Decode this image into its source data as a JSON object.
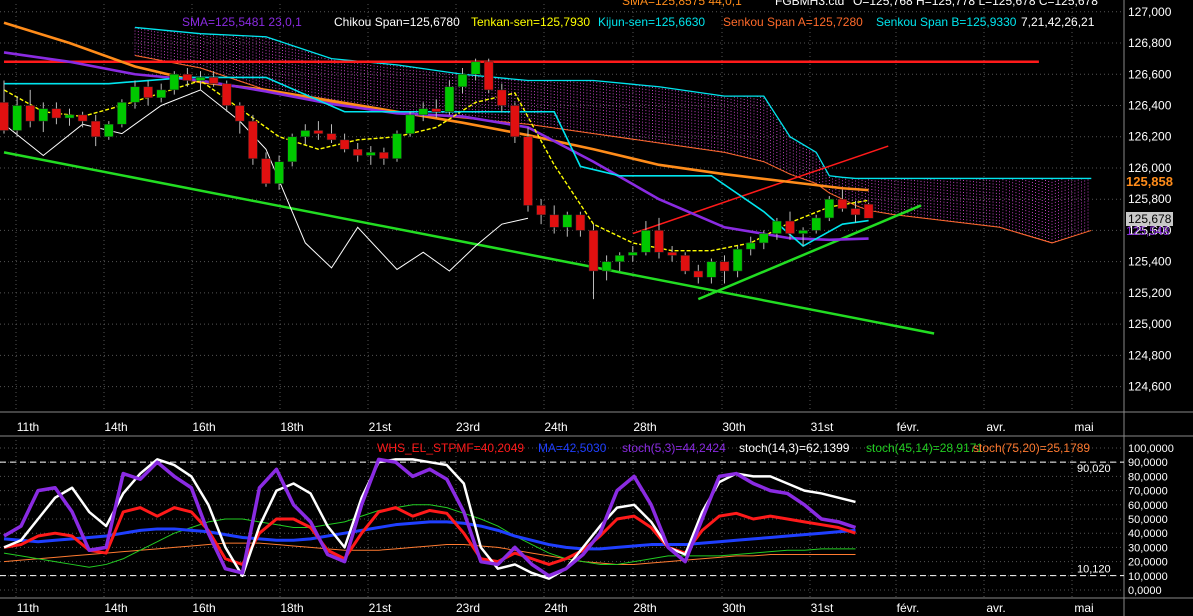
{
  "header": {
    "symbol": "FGBMH3.ctd",
    "ohlc": "O=125,768 H=125,778 L=125,678 C=125,678",
    "sma_main": "SMA=125,8575  44,0,1",
    "sma2": "SMA=125,5481  23,0,1",
    "chikou": "Chikou Span=125,6780",
    "tenkan": "Tenkan-sen=125,7930",
    "kijun": "Kijun-sen=125,6630",
    "senkou_a": "Senkou Span A=125,7280",
    "senkou_b": "Senkou Span B=125,9330",
    "ichimoku_params": "7,21,42,26,21"
  },
  "lower_header": {
    "whs": "WHS_EL_STPMF=40,2049",
    "ma": "MA=42,5030",
    "stoch53": "stoch(5,3)=44,2424",
    "stoch14": "stoch(14,3)=62,1399",
    "stoch45": "stoch(45,14)=28,9171",
    "stoch75": "stoch(75,20)=25,1789"
  },
  "price_labels": {
    "sma": "125,858",
    "close": "125,678",
    "sma2": "125,548"
  },
  "colors": {
    "bg": "#000000",
    "grid": "#555555",
    "up": "#00c800",
    "down": "#e01010",
    "sma": "#ff8c1a",
    "sma2": "#8a2be2",
    "tenkan": "#ffff00",
    "kijun": "#00e5ee",
    "chikou": "#ffffff",
    "cloud_b": "#00e5ee",
    "cloud_a": "#ff6a2a",
    "cloud_fill": "#ff55ff",
    "trend_red": "#ff1a1a",
    "trend_green": "#22dd22",
    "stoch5": "#8a2be2",
    "stoch14": "#ffffff",
    "whs": "#ff1a1a",
    "ma": "#1f3fff",
    "stoch45": "#22cc22",
    "stoch75": "#ff7a30"
  },
  "chart_data": [
    {
      "type": "candlestick",
      "title": "",
      "ylim": [
        124450,
        127050
      ],
      "y_ticks": [
        "127,000",
        "126,800",
        "126,600",
        "126,400",
        "126,200",
        "126,000",
        "125,800",
        "125,600",
        "125,400",
        "125,200",
        "125,000",
        "124,800",
        "124,600"
      ],
      "x_ticks": [
        "11th",
        "14th",
        "16th",
        "18th",
        "21st",
        "23rd",
        "24th",
        "28th",
        "30th",
        "31st",
        "févr.",
        "avr.",
        "mai"
      ],
      "candles": [
        [
          126420,
          126560,
          126220,
          126240
        ],
        [
          126240,
          126460,
          126200,
          126400
        ],
        [
          126400,
          126500,
          126260,
          126300
        ],
        [
          126300,
          126420,
          126230,
          126380
        ],
        [
          126380,
          126420,
          126280,
          126320
        ],
        [
          126320,
          126380,
          126270,
          126340
        ],
        [
          126340,
          126360,
          126260,
          126300
        ],
        [
          126300,
          126340,
          126140,
          126200
        ],
        [
          126200,
          126300,
          126180,
          126280
        ],
        [
          126280,
          126440,
          126260,
          126420
        ],
        [
          126420,
          126560,
          126380,
          126520
        ],
        [
          126520,
          126560,
          126400,
          126450
        ],
        [
          126450,
          126540,
          126420,
          126500
        ],
        [
          126500,
          126620,
          126470,
          126600
        ],
        [
          126600,
          126640,
          126520,
          126560
        ],
        [
          126560,
          126620,
          126500,
          126580
        ],
        [
          126580,
          126620,
          126520,
          126540
        ],
        [
          126540,
          126560,
          126360,
          126400
        ],
        [
          126400,
          126420,
          126220,
          126300
        ],
        [
          126300,
          126340,
          126020,
          126060
        ],
        [
          126060,
          126100,
          125880,
          125900
        ],
        [
          125900,
          126080,
          125860,
          126040
        ],
        [
          126040,
          126220,
          126010,
          126200
        ],
        [
          126200,
          126280,
          126150,
          126240
        ],
        [
          126240,
          126300,
          126180,
          126220
        ],
        [
          126220,
          126280,
          126160,
          126180
        ],
        [
          126180,
          126220,
          126100,
          126120
        ],
        [
          126120,
          126160,
          126040,
          126080
        ],
        [
          126080,
          126140,
          126020,
          126100
        ],
        [
          126100,
          126130,
          126020,
          126060
        ],
        [
          126060,
          126240,
          126040,
          126220
        ],
        [
          126220,
          126360,
          126200,
          126340
        ],
        [
          126340,
          126420,
          126300,
          126380
        ],
        [
          126380,
          126440,
          126320,
          126360
        ],
        [
          126360,
          126560,
          126340,
          126520
        ],
        [
          126520,
          126640,
          126480,
          126600
        ],
        [
          126600,
          126700,
          126560,
          126680
        ],
        [
          126680,
          126700,
          126480,
          126500
        ],
        [
          126500,
          126540,
          126360,
          126400
        ],
        [
          126400,
          126420,
          126160,
          126200
        ],
        [
          126200,
          126260,
          125720,
          125760
        ],
        [
          125760,
          125800,
          125640,
          125700
        ],
        [
          125700,
          125760,
          125580,
          125620
        ],
        [
          125620,
          125720,
          125560,
          125700
        ],
        [
          125700,
          125720,
          125560,
          125600
        ],
        [
          125600,
          125640,
          125160,
          125340
        ],
        [
          125340,
          125440,
          125280,
          125400
        ],
        [
          125400,
          125460,
          125340,
          125440
        ],
        [
          125440,
          125500,
          125400,
          125460
        ],
        [
          125460,
          125660,
          125440,
          125600
        ],
        [
          125600,
          125680,
          125420,
          125460
        ],
        [
          125460,
          125500,
          125400,
          125440
        ],
        [
          125440,
          125460,
          125320,
          125340
        ],
        [
          125340,
          125380,
          125260,
          125300
        ],
        [
          125300,
          125420,
          125260,
          125400
        ],
        [
          125400,
          125440,
          125260,
          125340
        ],
        [
          125340,
          125500,
          125300,
          125480
        ],
        [
          125480,
          125560,
          125440,
          125520
        ],
        [
          125520,
          125600,
          125480,
          125580
        ],
        [
          125580,
          125680,
          125540,
          125660
        ],
        [
          125660,
          125720,
          125540,
          125580
        ],
        [
          125580,
          125620,
          125500,
          125600
        ],
        [
          125600,
          125700,
          125580,
          125680
        ],
        [
          125680,
          125820,
          125660,
          125800
        ],
        [
          125800,
          125860,
          125720,
          125740
        ],
        [
          125740,
          125790,
          125650,
          125700
        ],
        [
          125768,
          125778,
          125678,
          125678
        ]
      ],
      "series": [
        {
          "key": "sma",
          "name": "SMA",
          "x": [
            0,
            5,
            10,
            15,
            20,
            25,
            30,
            35,
            40,
            45,
            50,
            55,
            60,
            64,
            66
          ],
          "y": [
            126930,
            126800,
            126650,
            126550,
            126500,
            126430,
            126360,
            126290,
            126210,
            126120,
            126020,
            125960,
            125910,
            125870,
            125858
          ]
        },
        {
          "key": "sma2",
          "name": "SMA",
          "x": [
            0,
            5,
            10,
            15,
            20,
            25,
            30,
            35,
            40,
            45,
            50,
            55,
            60,
            63,
            66
          ],
          "y": [
            126740,
            126680,
            126600,
            126560,
            126490,
            126410,
            126350,
            126330,
            126260,
            126040,
            125800,
            125620,
            125550,
            125540,
            125548
          ]
        },
        {
          "key": "tenkan",
          "name": "Tenkan-sen",
          "x": [
            0,
            3,
            6,
            9,
            12,
            15,
            18,
            21,
            24,
            27,
            30,
            33,
            36,
            39,
            42,
            45,
            48,
            51,
            54,
            57,
            60,
            63,
            66
          ],
          "y": [
            126500,
            126360,
            126330,
            126400,
            126480,
            126560,
            126380,
            126200,
            126120,
            126180,
            126200,
            126260,
            126420,
            126480,
            126020,
            125640,
            125520,
            125470,
            125470,
            125520,
            125650,
            125750,
            125793
          ]
        },
        {
          "key": "kijun",
          "name": "Kijun-sen",
          "x": [
            0,
            8,
            14,
            20,
            26,
            32,
            38,
            42,
            44,
            47,
            50,
            54,
            58,
            61,
            64,
            66
          ],
          "y": [
            126540,
            126540,
            126580,
            126580,
            126360,
            126360,
            126360,
            126360,
            126010,
            125950,
            125950,
            125950,
            125720,
            125500,
            125640,
            125663
          ]
        },
        {
          "key": "chikou",
          "name": "Chikou Span",
          "x": [
            0,
            3,
            6,
            9,
            12,
            15,
            18,
            20,
            23,
            25,
            27,
            30,
            32,
            34,
            36,
            38,
            40
          ],
          "y": [
            126280,
            126080,
            126280,
            126220,
            126400,
            126500,
            126300,
            126120,
            125520,
            125360,
            125620,
            125350,
            125460,
            125340,
            125500,
            125640,
            125678
          ]
        }
      ],
      "cloud": {
        "x": [
          10,
          15,
          20,
          25,
          30,
          35,
          40,
          45,
          50,
          55,
          58,
          60,
          62,
          63,
          64,
          65,
          66,
          68,
          72,
          76,
          80,
          83
        ],
        "senkou_a": [
          126720,
          126640,
          126500,
          126420,
          126360,
          126320,
          126280,
          126220,
          126160,
          126100,
          126040,
          125960,
          125900,
          125840,
          125800,
          125760,
          125728,
          125700,
          125660,
          125620,
          125520,
          125600
        ],
        "senkou_b": [
          126900,
          126860,
          126840,
          126700,
          126660,
          126600,
          126560,
          126560,
          126520,
          126460,
          126460,
          126200,
          126100,
          125950,
          125940,
          125933,
          125933,
          125933,
          125933,
          125933,
          125933,
          125933
        ]
      },
      "trendlines": [
        {
          "key": "resistance_red",
          "y_start": 126680,
          "y_end": 126680,
          "x_start": 0,
          "x_end": 79
        },
        {
          "key": "channel_red_up",
          "x_start": 48,
          "y_start": 125580,
          "x_end": 67.5,
          "y_end": 126140
        },
        {
          "key": "channel_green_low",
          "x_start": 53,
          "y_start": 125160,
          "x_end": 70,
          "y_end": 125760
        },
        {
          "key": "support_green",
          "x_start": 0,
          "y_start": 126100,
          "x_end": 71,
          "y_end": 124940
        }
      ]
    },
    {
      "type": "line",
      "title": "",
      "ylim": [
        0,
        100000
      ],
      "y_ticks": [
        "100,0000",
        "90,0000",
        "80,0000",
        "70,0000",
        "60,0000",
        "50,0000",
        "40,0000",
        "30,0000",
        "20,0000",
        "10,0000",
        "0,0000"
      ],
      "levels": [
        "90,020",
        "10,120"
      ],
      "x_ticks": [
        "11th",
        "14th",
        "16th",
        "18th",
        "21st",
        "23rd",
        "24th",
        "28th",
        "30th",
        "31st",
        "févr.",
        "avr.",
        "mai"
      ],
      "series": [
        {
          "key": "stoch5",
          "name": "stoch(5,3)",
          "values": [
            38,
            45,
            70,
            72,
            55,
            28,
            30,
            82,
            78,
            90,
            80,
            72,
            40,
            15,
            12,
            72,
            85,
            60,
            48,
            25,
            20,
            60,
            92,
            90,
            80,
            85,
            78,
            55,
            20,
            18,
            30,
            18,
            10,
            15,
            25,
            40,
            70,
            80,
            60,
            30,
            20,
            50,
            80,
            82,
            75,
            70,
            68,
            60,
            50,
            48,
            44
          ]
        },
        {
          "key": "stoch14",
          "name": "stoch(14,3)",
          "values": [
            30,
            35,
            50,
            65,
            72,
            55,
            45,
            68,
            82,
            92,
            88,
            80,
            60,
            30,
            10,
            45,
            70,
            75,
            68,
            45,
            30,
            65,
            90,
            92,
            92,
            90,
            88,
            75,
            30,
            15,
            18,
            12,
            8,
            15,
            30,
            45,
            58,
            60,
            48,
            30,
            25,
            55,
            76,
            82,
            80,
            80,
            75,
            70,
            68,
            65,
            62
          ]
        },
        {
          "key": "whs",
          "name": "WHS_EL_STPMF",
          "values": [
            30,
            32,
            38,
            40,
            38,
            28,
            26,
            55,
            58,
            52,
            58,
            55,
            42,
            22,
            18,
            40,
            50,
            50,
            44,
            28,
            22,
            40,
            55,
            58,
            52,
            56,
            54,
            40,
            22,
            20,
            26,
            22,
            18,
            22,
            28,
            38,
            50,
            52,
            44,
            30,
            26,
            42,
            52,
            54,
            50,
            52,
            50,
            48,
            46,
            44,
            40
          ]
        },
        {
          "key": "ma",
          "name": "MA",
          "values": [
            36,
            35,
            34,
            35,
            36,
            37,
            38,
            40,
            42,
            43,
            43,
            42,
            41,
            39,
            37,
            36,
            35,
            35,
            36,
            38,
            40,
            42,
            44,
            46,
            47,
            48,
            48,
            47,
            45,
            42,
            38,
            35,
            32,
            30,
            29,
            29,
            30,
            31,
            32,
            32,
            32,
            33,
            34,
            35,
            36,
            37,
            38,
            39,
            40,
            41,
            42
          ]
        },
        {
          "key": "stoch45",
          "name": "stoch(45,14)",
          "values": [
            26,
            24,
            22,
            20,
            18,
            16,
            18,
            22,
            28,
            34,
            40,
            44,
            48,
            50,
            50,
            48,
            46,
            44,
            44,
            46,
            48,
            52,
            56,
            58,
            60,
            60,
            58,
            54,
            50,
            45,
            38,
            32,
            26,
            22,
            20,
            18,
            18,
            20,
            22,
            24,
            24,
            24,
            24,
            25,
            26,
            27,
            28,
            28,
            29,
            29,
            29
          ]
        },
        {
          "key": "stoch75",
          "name": "stoch(75,20)",
          "values": [
            20,
            21,
            22,
            23,
            24,
            25,
            26,
            27,
            28,
            29,
            30,
            31,
            32,
            33,
            33,
            33,
            32,
            31,
            30,
            29,
            28,
            28,
            28,
            29,
            30,
            31,
            32,
            32,
            31,
            30,
            28,
            26,
            24,
            22,
            20,
            19,
            18,
            18,
            19,
            20,
            21,
            22,
            23,
            24,
            24,
            25,
            25,
            25,
            25,
            25,
            25
          ]
        }
      ]
    }
  ]
}
